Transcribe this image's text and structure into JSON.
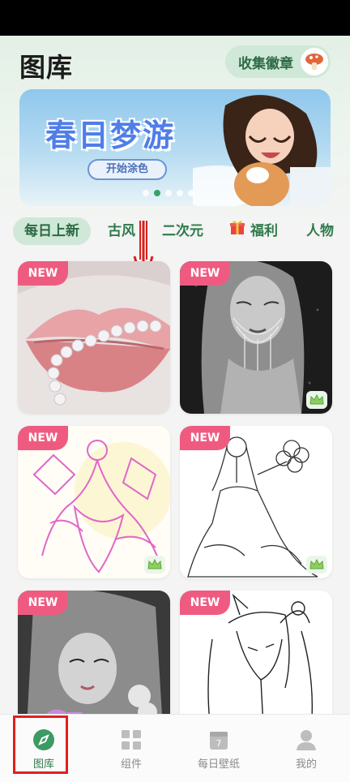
{
  "header": {
    "title": "图库",
    "badge_button_label": "收集徽章"
  },
  "banner": {
    "title": "春日梦游",
    "button_label": "开始涂色",
    "dots_count": 5,
    "active_dot": 1
  },
  "categories": [
    {
      "label": "每日上新",
      "active": true
    },
    {
      "label": "古风",
      "active": false
    },
    {
      "label": "二次元",
      "active": false
    },
    {
      "label": "福利",
      "active": false,
      "icon": "gift-icon"
    },
    {
      "label": "人物",
      "active": false
    }
  ],
  "cards": [
    {
      "badge": "NEW",
      "subject": "lips with pearls",
      "premium": false
    },
    {
      "badge": "NEW",
      "subject": "woman with face chains",
      "premium": true
    },
    {
      "badge": "NEW",
      "subject": "pink line art dancer",
      "premium": true
    },
    {
      "badge": "NEW",
      "subject": "bride with bouquet line art",
      "premium": true
    },
    {
      "badge": "NEW",
      "subject": "girl with butterfly",
      "premium": false
    },
    {
      "badge": "NEW",
      "subject": "horned figure line art",
      "premium": false
    }
  ],
  "tabbar": [
    {
      "label": "图库",
      "icon": "compass-icon",
      "active": true
    },
    {
      "label": "组件",
      "icon": "widgets-icon",
      "active": false
    },
    {
      "label": "每日壁纸",
      "icon": "calendar-icon",
      "active": false,
      "icon_text": "7"
    },
    {
      "label": "我的",
      "icon": "user-icon",
      "active": false
    }
  ],
  "colors": {
    "accent": "#2f7a4c",
    "new_badge": "#ef5b80",
    "annotation": "#e0201f"
  }
}
